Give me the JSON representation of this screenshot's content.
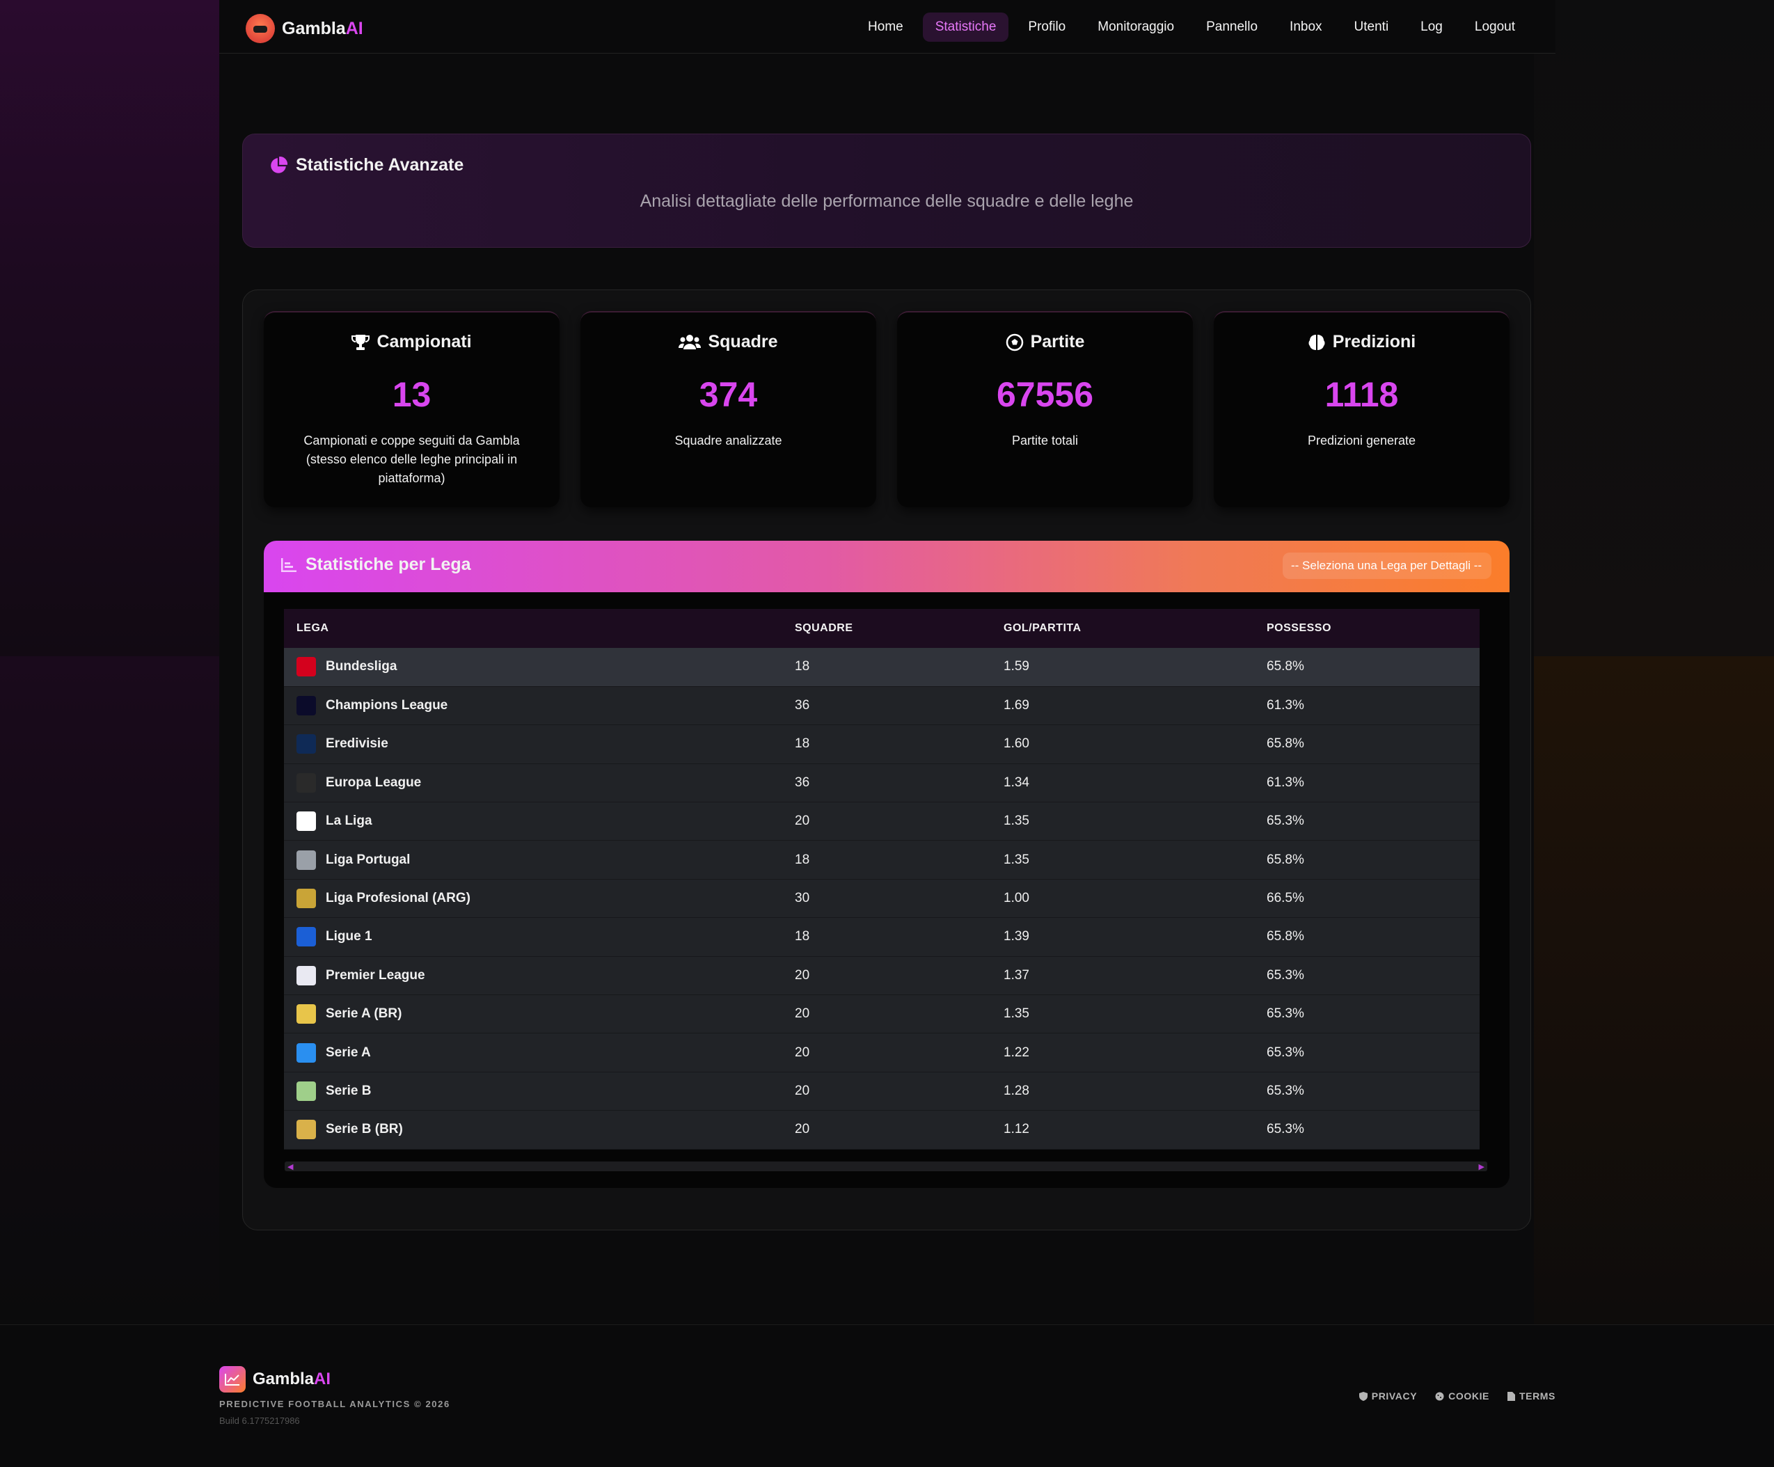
{
  "nav": {
    "brand_main": "Gambla",
    "brand_ai": "AI",
    "links": [
      {
        "label": "Home"
      },
      {
        "label": "Statistiche"
      },
      {
        "label": "Profilo"
      },
      {
        "label": "Monitoraggio"
      },
      {
        "label": "Pannello"
      },
      {
        "label": "Inbox"
      },
      {
        "label": "Utenti"
      },
      {
        "label": "Log"
      },
      {
        "label": "Logout"
      }
    ],
    "active": "Statistiche"
  },
  "hero": {
    "title": "Statistiche Avanzate",
    "subtitle": "Analisi dettagliate delle performance delle squadre e delle leghe"
  },
  "cards": [
    {
      "icon": "trophy-icon",
      "title": "Campionati",
      "value": "13",
      "desc": "Campionati e coppe seguiti da Gambla (stesso elenco delle leghe principali in piattaforma)"
    },
    {
      "icon": "users-icon",
      "title": "Squadre",
      "value": "374",
      "desc": "Squadre analizzate"
    },
    {
      "icon": "football-icon",
      "title": "Partite",
      "value": "67556",
      "desc": "Partite totali"
    },
    {
      "icon": "brain-icon",
      "title": "Predizioni",
      "value": "1118",
      "desc": "Predizioni generate"
    }
  ],
  "league_section": {
    "title": "Statistiche per Lega",
    "select_value": "-- Seleziona una Lega per Dettagli --",
    "columns": [
      "LEGA",
      "SQUADRE",
      "GOL/PARTITA",
      "POSSESSO"
    ],
    "rows": [
      {
        "league": "Bundesliga",
        "teams": "18",
        "goals": "1.59",
        "possession": "65.8%",
        "color": "#d4011d"
      },
      {
        "league": "Champions League",
        "teams": "36",
        "goals": "1.69",
        "possession": "61.3%",
        "color": "#0b0b2a"
      },
      {
        "league": "Eredivisie",
        "teams": "18",
        "goals": "1.60",
        "possession": "65.8%",
        "color": "#0f2a56"
      },
      {
        "league": "Europa League",
        "teams": "36",
        "goals": "1.34",
        "possession": "61.3%",
        "color": "#2a2a2a"
      },
      {
        "league": "La Liga",
        "teams": "20",
        "goals": "1.35",
        "possession": "65.3%",
        "color": "#ffffff"
      },
      {
        "league": "Liga Portugal",
        "teams": "18",
        "goals": "1.35",
        "possession": "65.8%",
        "color": "#9aa0a8"
      },
      {
        "league": "Liga Profesional (ARG)",
        "teams": "30",
        "goals": "1.00",
        "possession": "66.5%",
        "color": "#c9a437"
      },
      {
        "league": "Ligue 1",
        "teams": "18",
        "goals": "1.39",
        "possession": "65.8%",
        "color": "#1b5fd6"
      },
      {
        "league": "Premier League",
        "teams": "20",
        "goals": "1.37",
        "possession": "65.3%",
        "color": "#e9e9f2"
      },
      {
        "league": "Serie A (BR)",
        "teams": "20",
        "goals": "1.35",
        "possession": "65.3%",
        "color": "#e8c54a"
      },
      {
        "league": "Serie A",
        "teams": "20",
        "goals": "1.22",
        "possession": "65.3%",
        "color": "#2a8ff0"
      },
      {
        "league": "Serie B",
        "teams": "20",
        "goals": "1.28",
        "possession": "65.3%",
        "color": "#9fcf8a"
      },
      {
        "league": "Serie B (BR)",
        "teams": "20",
        "goals": "1.12",
        "possession": "65.3%",
        "color": "#d9b14a"
      }
    ]
  },
  "footer": {
    "brand_main": "Gambla",
    "brand_ai": "AI",
    "tagline": "PREDICTIVE FOOTBALL ANALYTICS © 2026",
    "build": "Build 6.1775217986",
    "links": [
      {
        "label": "PRIVACY",
        "icon": "shield-icon"
      },
      {
        "label": "COOKIE",
        "icon": "cookie-icon"
      },
      {
        "label": "TERMS",
        "icon": "document-icon"
      }
    ]
  },
  "colors": {
    "accent": "#d946ef",
    "accent_orange": "#fb7d2a",
    "background": "#0b0b0c"
  }
}
